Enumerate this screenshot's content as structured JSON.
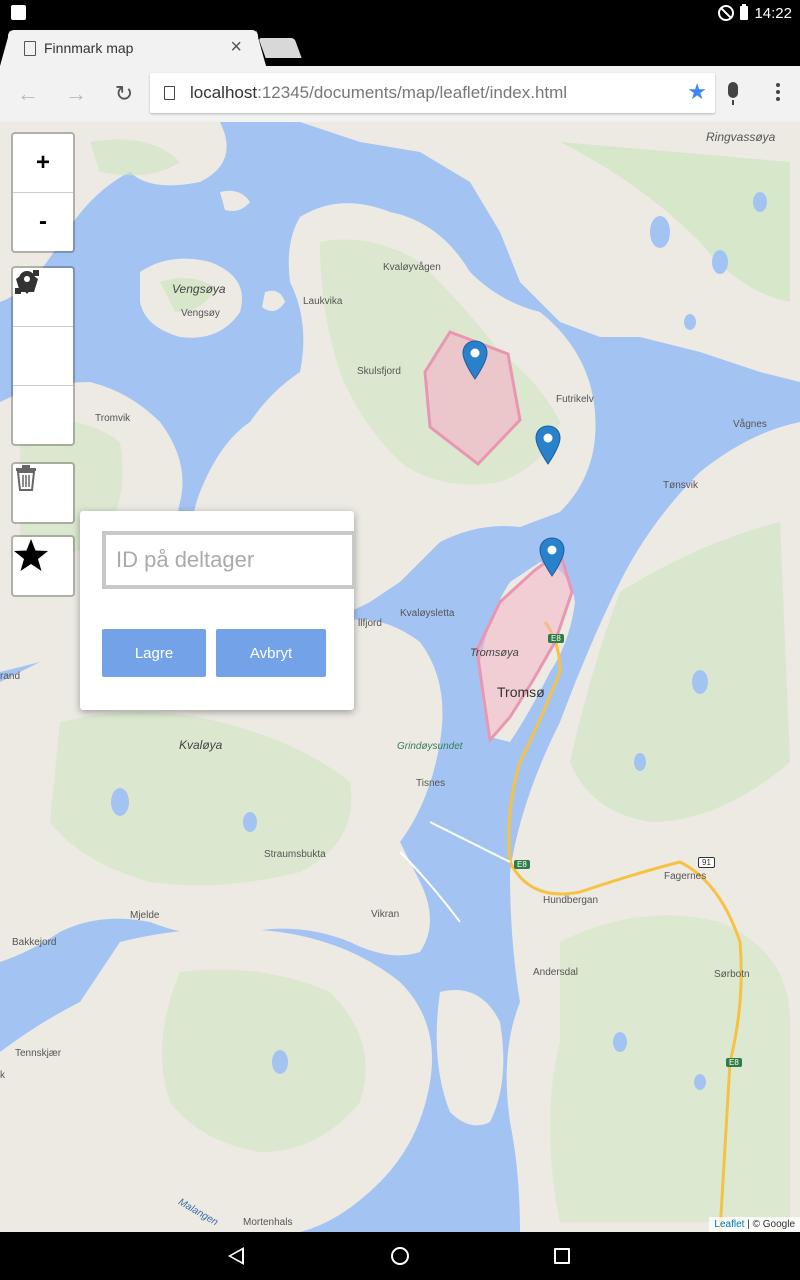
{
  "status": {
    "time": "14:22"
  },
  "browser": {
    "tab_title": "Finnmark map",
    "tab_close": "×",
    "url_host": "localhost",
    "url_path": ":12345/documents/map/leaflet/index.html",
    "back_icon": "←",
    "forward_icon": "→",
    "reload_icon": "↻",
    "star_icon": "★"
  },
  "map": {
    "zoom_in": "+",
    "zoom_out": "-",
    "labels": {
      "ringvassoya": "Ringvassøya",
      "vengsoya_island": "Vengsøya",
      "vengsoy": "Vengsøy",
      "kvaloyvagen": "Kvaløyvågen",
      "laukvika": "Laukvika",
      "skulsfjord": "Skulsfjord",
      "futrikelv": "Futrikelv",
      "tromvik": "Tromvik",
      "vagnes": "Vågnes",
      "tonsvik": "Tønsvik",
      "kvaloysletta": "Kvaløysletta",
      "llfjord": "llfjord",
      "tromsoya": "Tromsøya",
      "tromso": "Tromsø",
      "rand": "rand",
      "kvaloya": "Kvaløya",
      "grindoysundet": "Grindøysundet",
      "tisnes": "Tisnes",
      "straumsbukta": "Straumsbukta",
      "fagernes": "Fagernes",
      "hundbergan": "Hundbergan",
      "mjelde": "Mjelde",
      "vikran": "Vikran",
      "bakkejord": "Bakkejord",
      "andersdal": "Andersdal",
      "sorbotn": "Sørbotn",
      "tennskjaer": "Tennskjær",
      "k": "k",
      "mortenhals": "Mortenhals",
      "malangen": "Malangen",
      "e8_1": "E8",
      "e8_2": "E8",
      "e8_3": "E8",
      "r91": "91"
    },
    "attribution_link": "Leaflet",
    "attribution_text": " | © Google"
  },
  "popup": {
    "placeholder": "ID på deltager",
    "save_label": "Lagre",
    "cancel_label": "Avbryt"
  },
  "colors": {
    "water": "#a3c4f3",
    "land": "#eceae3",
    "green": "#cde5bf",
    "polygon_fill": "#f4b6c9",
    "polygon_stroke": "#e996b3",
    "marker": "#2a81cb",
    "road": "#f6c244",
    "button": "#74a2e8"
  }
}
